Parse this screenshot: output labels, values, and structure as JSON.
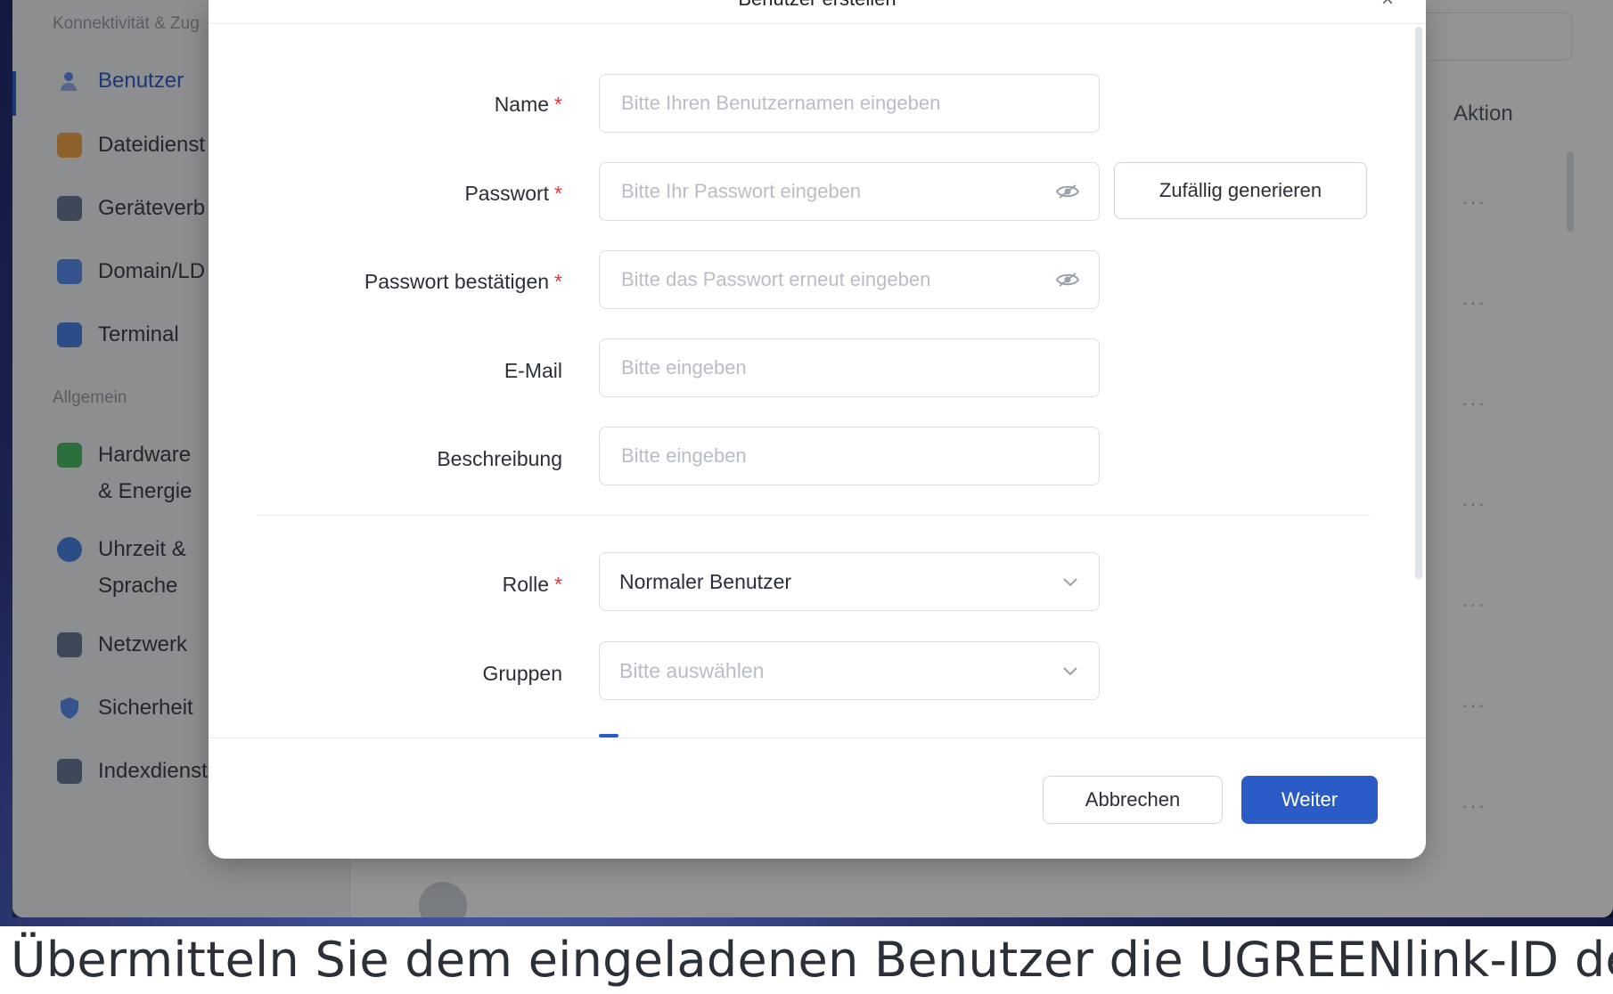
{
  "sidebar": {
    "section_connectivity": "Konnektivität & Zug",
    "section_general": "Allgemein",
    "items": [
      {
        "label": "Benutzer",
        "icon": "user-icon"
      },
      {
        "label": "Dateidienst",
        "icon": "folder-icon"
      },
      {
        "label": "Geräteverb",
        "icon": "device-icon"
      },
      {
        "label": "Domain/LD",
        "icon": "domain-icon"
      },
      {
        "label": "Terminal",
        "icon": "terminal-icon"
      },
      {
        "label": "Hardware & Energie",
        "icon": "battery-icon"
      },
      {
        "label": "Uhrzeit & Sprache",
        "icon": "globe-icon"
      },
      {
        "label": "Netzwerk",
        "icon": "network-icon"
      },
      {
        "label": "Sicherheit",
        "icon": "shield-icon"
      },
      {
        "label": "Indexdienst",
        "icon": "index-icon"
      }
    ]
  },
  "background": {
    "action_header": "Aktion",
    "row_menu": "···"
  },
  "modal": {
    "title": "Benutzer erstellen",
    "close": "×",
    "required_mark": "*",
    "fields": {
      "name": {
        "label": "Name",
        "placeholder": "Bitte Ihren Benutzernamen eingeben"
      },
      "password": {
        "label": "Passwort",
        "placeholder": "Bitte Ihr Passwort eingeben"
      },
      "password_confirm": {
        "label": "Passwort bestätigen",
        "placeholder": "Bitte das Passwort erneut eingeben"
      },
      "email": {
        "label": "E-Mail",
        "placeholder": "Bitte eingeben"
      },
      "description": {
        "label": "Beschreibung",
        "placeholder": "Bitte eingeben"
      },
      "role": {
        "label": "Rolle",
        "value": "Normaler Benutzer"
      },
      "groups": {
        "label": "Gruppen",
        "placeholder": "Bitte auswählen"
      }
    },
    "generate_button": "Zufällig generieren",
    "cancel_button": "Abbrechen",
    "next_button": "Weiter"
  },
  "caption": "Übermitteln Sie dem eingeladenen Benutzer die UGREENlink-ID des",
  "colors": {
    "accent": "#2a5bc7",
    "required": "#e0353b"
  }
}
